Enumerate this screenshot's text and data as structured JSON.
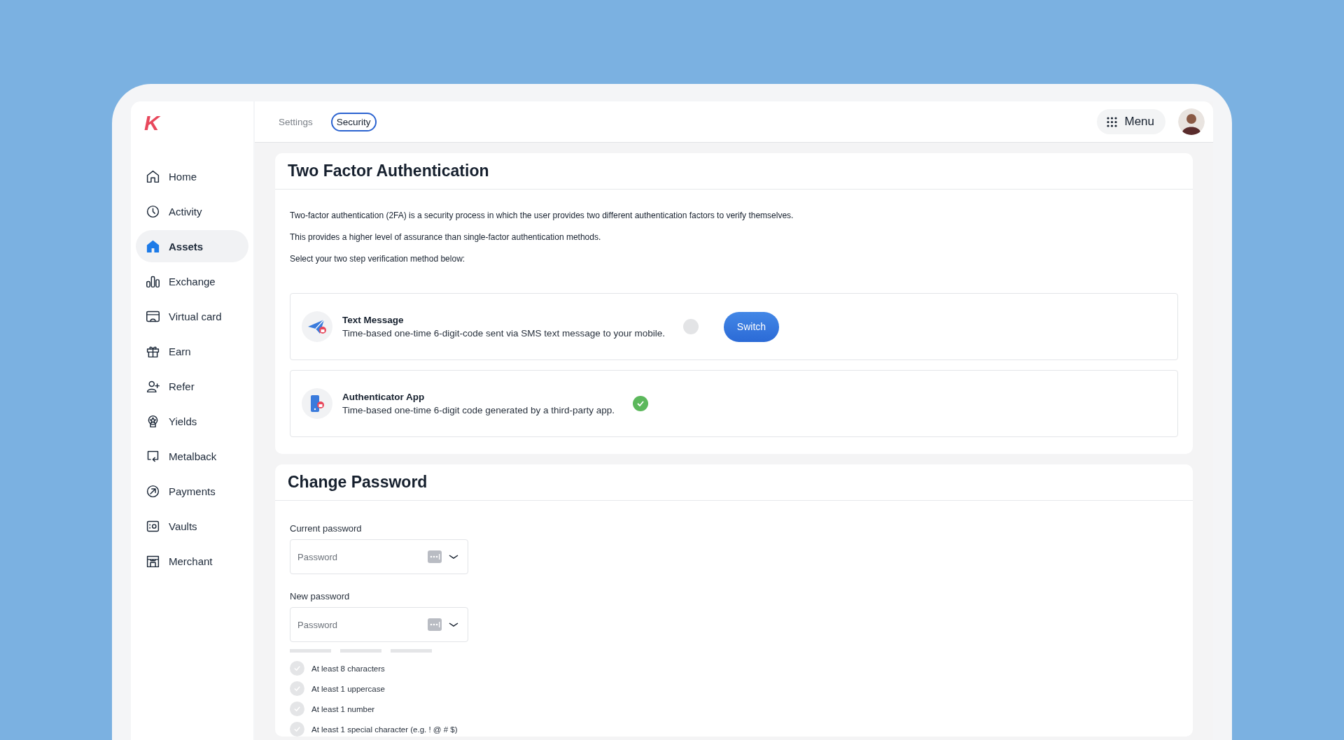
{
  "sidebar": {
    "logo": "K",
    "items": [
      {
        "label": "Home",
        "selected": false
      },
      {
        "label": "Activity",
        "selected": false
      },
      {
        "label": "Assets",
        "selected": true
      },
      {
        "label": "Exchange",
        "selected": false
      },
      {
        "label": "Virtual card",
        "selected": false
      },
      {
        "label": "Earn",
        "selected": false
      },
      {
        "label": "Refer",
        "selected": false
      },
      {
        "label": "Yields",
        "selected": false
      },
      {
        "label": "Metalback",
        "selected": false
      },
      {
        "label": "Payments",
        "selected": false
      },
      {
        "label": "Vaults",
        "selected": false
      },
      {
        "label": "Merchant",
        "selected": false
      }
    ]
  },
  "tabs": [
    {
      "label": "Settings",
      "selected": false
    },
    {
      "label": "Security",
      "selected": true
    }
  ],
  "menu_button": "Menu",
  "two_factor": {
    "title": "Two Factor Authentication",
    "paragraphs": [
      "Two-factor authentication (2FA) is a security process in which the user provides two different authentication factors to verify themselves.",
      "This provides a higher level of assurance than single-factor authentication methods.",
      "Select your two step verification method below:"
    ],
    "methods": [
      {
        "kind": "sms",
        "title": "Text Message",
        "description": "Time-based one-time 6-digit-code sent via SMS text message to your mobile.",
        "selected": false,
        "button": "Switch"
      },
      {
        "kind": "app",
        "title": "Authenticator App",
        "description": "Time-based one-time 6-digit code generated by a third-party app.",
        "selected": true
      }
    ]
  },
  "change_password": {
    "title": "Change Password",
    "fields": [
      {
        "label": "Current password",
        "placeholder": "Password"
      },
      {
        "label": "New password",
        "placeholder": "Password"
      }
    ],
    "rules": [
      {
        "label": "At least 8 characters",
        "checked": false
      },
      {
        "label": "At least 1 uppercase",
        "checked": false
      },
      {
        "label": "At least 1 number",
        "checked": false
      },
      {
        "label": "At least 1 special character (e.g. ! @ # $)",
        "checked": false
      }
    ]
  }
}
